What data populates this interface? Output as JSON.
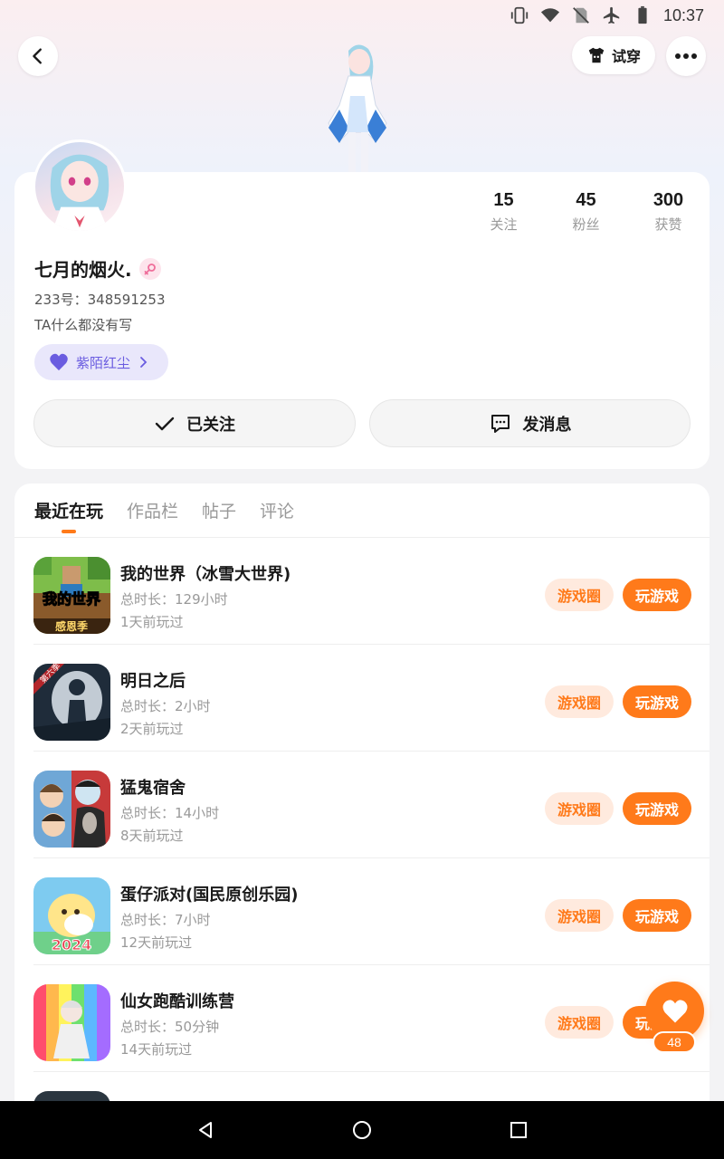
{
  "status_bar": {
    "time": "10:37"
  },
  "header": {
    "tryon_label": "试穿"
  },
  "profile": {
    "nickname": "七月的烟火.",
    "user_id": "233号：348591253",
    "bio": "TA什么都没有写",
    "title_badge": "紫陌红尘",
    "stats": [
      {
        "value": "15",
        "label": "关注"
      },
      {
        "value": "45",
        "label": "粉丝"
      },
      {
        "value": "300",
        "label": "获赞"
      }
    ],
    "follow_label": "已关注",
    "message_label": "发消息"
  },
  "tabs": [
    {
      "label": "最近在玩",
      "active": true
    },
    {
      "label": "作品栏",
      "active": false
    },
    {
      "label": "帖子",
      "active": false
    },
    {
      "label": "评论",
      "active": false
    }
  ],
  "games": [
    {
      "name": "我的世界（冰雪大世界)",
      "duration": "总时长：129小时",
      "last_played": "1天前玩过",
      "circle_label": "游戏圈",
      "play_label": "玩游戏"
    },
    {
      "name": "明日之后",
      "duration": "总时长：2小时",
      "last_played": "2天前玩过",
      "circle_label": "游戏圈",
      "play_label": "玩游戏"
    },
    {
      "name": "猛鬼宿舍",
      "duration": "总时长：14小时",
      "last_played": "8天前玩过",
      "circle_label": "游戏圈",
      "play_label": "玩游戏"
    },
    {
      "name": "蛋仔派对(国民原创乐园)",
      "duration": "总时长：7小时",
      "last_played": "12天前玩过",
      "circle_label": "游戏圈",
      "play_label": "玩游戏"
    },
    {
      "name": "仙女跑酷训练营",
      "duration": "总时长：50分钟",
      "last_played": "14天前玩过",
      "circle_label": "游戏圈",
      "play_label": "玩游戏"
    }
  ],
  "game_icon_text": {
    "minecraft_logo": "我的世界",
    "minecraft_sub": "感恩季",
    "lifeafter_ribbon": "第六季",
    "eggy_year": "2024"
  },
  "like": {
    "count": "48"
  },
  "colors": {
    "accent": "#ff7a1a",
    "accent_light": "#ffeade",
    "badge_purple": "#6a5ce0"
  }
}
